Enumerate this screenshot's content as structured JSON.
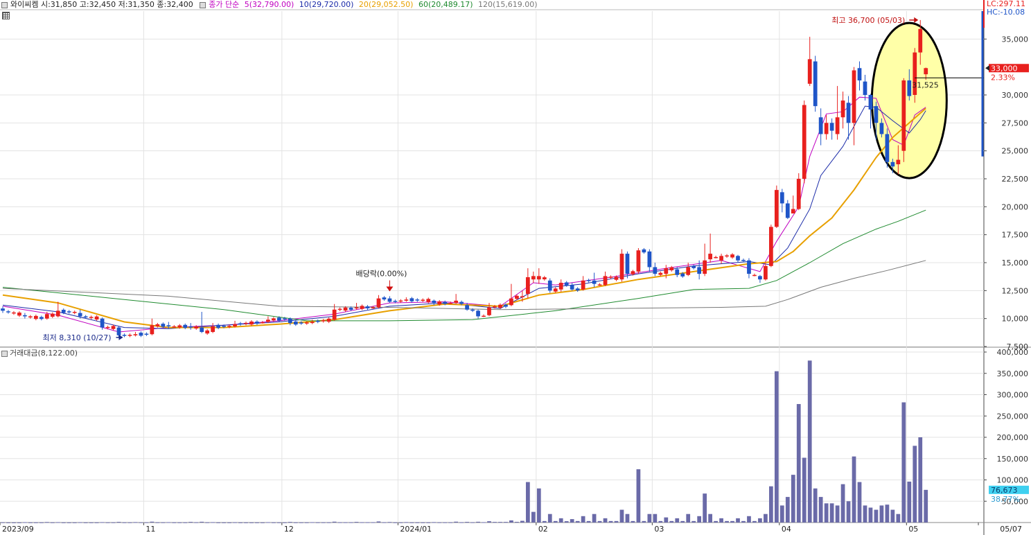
{
  "header": {
    "stock_info": "와이씨켐 시:31,850 고:32,450 저:31,350 종:32,400",
    "ma_title": "종가 단순",
    "ma": [
      {
        "label": "5(32,790.00)",
        "color": "#c000c0"
      },
      {
        "label": "10(29,720.00)",
        "color": "#1a2aa8"
      },
      {
        "label": "20(29,052.50)",
        "color": "#e8a000"
      },
      {
        "label": "60(20,489.17)",
        "color": "#1e8a2e"
      },
      {
        "label": "120(15,619.00)",
        "color": "#777777"
      }
    ]
  },
  "right_panel": {
    "lc": "LC:297.11",
    "hc": "HC:-10.08",
    "price_tag": "33,000",
    "price_change": "2.33%",
    "vol_tag": "76,673",
    "vol_change": "38.77%"
  },
  "volume_panel": {
    "label": "거래대금(8,122.00)"
  },
  "annotations": {
    "high": "최고 36,700 (05/03)",
    "low": "최저 8,310 (10/27)",
    "dividend": "배당락(0.00%)",
    "crosshair_value": "31,525"
  },
  "colors": {
    "up": "#e8201e",
    "down": "#1f55c8",
    "volume": "#6a6aa8",
    "highlight_fill": "#ffffa8"
  },
  "chart_data": {
    "type": "candlestick",
    "price_ylim": [
      7500,
      37500
    ],
    "price_ticks": [
      7500,
      10000,
      12500,
      15000,
      17500,
      20000,
      22500,
      25000,
      27500,
      30000,
      35000
    ],
    "price_tick_labels": [
      "7,500",
      "10,000",
      "12,500",
      "15,000",
      "17,500",
      "20,000",
      "22,500",
      "25,000",
      "27,500",
      "30,000",
      "35,000"
    ],
    "volume_ylim": [
      0,
      400000
    ],
    "volume_ticks": [
      50000,
      100000,
      150000,
      200000,
      250000,
      300000,
      350000,
      400000
    ],
    "volume_tick_labels": [
      "50,000",
      "100,000",
      "150,000",
      "200,000",
      "250,000",
      "300,000",
      "350,000",
      "400,000"
    ],
    "x_labels": [
      {
        "label": "2023/09",
        "index": 0
      },
      {
        "label": "11",
        "index": 26
      },
      {
        "label": "12",
        "index": 51
      },
      {
        "label": "2024/01",
        "index": 72
      },
      {
        "label": "02",
        "index": 97
      },
      {
        "label": "03",
        "index": 118
      },
      {
        "label": "04",
        "index": 141
      },
      {
        "label": "05",
        "index": 164
      },
      {
        "label": "05/07",
        "index": 177
      }
    ],
    "x_count": 178,
    "low_marker_index": 22,
    "dividend_marker_index": 70,
    "candle_anchors": [
      [
        0,
        10900,
        10700,
        11100,
        10500,
        500
      ],
      [
        4,
        10300,
        10200,
        10500,
        10000,
        800
      ],
      [
        8,
        10000,
        10400,
        10600,
        9900,
        1200
      ],
      [
        10,
        10200,
        10700,
        11500,
        10100,
        900
      ],
      [
        14,
        10500,
        10200,
        10800,
        10000,
        700
      ],
      [
        18,
        10000,
        9200,
        10100,
        9000,
        900
      ],
      [
        21,
        9200,
        8500,
        9300,
        8310,
        1500
      ],
      [
        24,
        8500,
        8600,
        8800,
        8400,
        1000
      ],
      [
        27,
        8600,
        9400,
        10000,
        8500,
        2000
      ],
      [
        30,
        9400,
        9300,
        9700,
        9100,
        800
      ],
      [
        34,
        9300,
        9200,
        9600,
        9000,
        1500
      ],
      [
        36,
        9200,
        8800,
        10600,
        8700,
        1800
      ],
      [
        38,
        8800,
        9300,
        9600,
        8700,
        900
      ],
      [
        42,
        9300,
        9500,
        9800,
        9200,
        600
      ],
      [
        48,
        9700,
        9900,
        10200,
        9600,
        800
      ],
      [
        52,
        10000,
        9600,
        10100,
        9400,
        1400
      ],
      [
        56,
        9600,
        9700,
        9900,
        9500,
        800
      ],
      [
        60,
        9900,
        10800,
        11300,
        9800,
        2000
      ],
      [
        64,
        10900,
        11000,
        11400,
        10800,
        1500
      ],
      [
        68,
        11000,
        11800,
        12100,
        10900,
        2500
      ],
      [
        70,
        11800,
        11500,
        12000,
        11400,
        1200
      ],
      [
        73,
        11600,
        11700,
        11900,
        11500,
        1000
      ],
      [
        78,
        11600,
        11400,
        11700,
        11200,
        1000
      ],
      [
        82,
        11400,
        11600,
        12200,
        11300,
        2000
      ],
      [
        84,
        11200,
        10800,
        11400,
        10700,
        1500
      ],
      [
        86,
        10700,
        10200,
        10800,
        10000,
        1800
      ],
      [
        88,
        10300,
        11000,
        11400,
        10200,
        3000
      ],
      [
        92,
        11200,
        11800,
        13100,
        11100,
        5000
      ],
      [
        94,
        12000,
        12000,
        12500,
        11500,
        4000
      ],
      [
        95,
        12200,
        13700,
        14500,
        11800,
        95000
      ],
      [
        96,
        13500,
        13800,
        14200,
        13200,
        25000
      ],
      [
        97,
        13500,
        13800,
        14500,
        13100,
        80000
      ],
      [
        99,
        13400,
        12500,
        13600,
        12300,
        20000
      ],
      [
        101,
        12600,
        13200,
        13500,
        12400,
        10000
      ],
      [
        103,
        13000,
        12600,
        13200,
        12500,
        8000
      ],
      [
        105,
        12600,
        13400,
        13800,
        12500,
        15000
      ],
      [
        107,
        13400,
        13100,
        14100,
        12800,
        20000
      ],
      [
        109,
        13000,
        13800,
        14200,
        12900,
        10000
      ],
      [
        112,
        13500,
        15800,
        16200,
        13300,
        30000
      ],
      [
        113,
        15800,
        14000,
        16000,
        13600,
        20000
      ],
      [
        115,
        14200,
        16100,
        16300,
        14000,
        125000
      ],
      [
        117,
        16000,
        14600,
        16200,
        14200,
        20000
      ],
      [
        118,
        14600,
        14000,
        15000,
        13800,
        20000
      ],
      [
        120,
        14000,
        14500,
        14800,
        13600,
        12000
      ],
      [
        122,
        14400,
        13900,
        14600,
        13700,
        10000
      ],
      [
        124,
        13900,
        14600,
        15000,
        13800,
        20000
      ],
      [
        126,
        14600,
        14000,
        15200,
        13500,
        15000
      ],
      [
        127,
        14000,
        15200,
        16700,
        13800,
        68000
      ],
      [
        128,
        15300,
        15800,
        17600,
        15000,
        20000
      ],
      [
        130,
        15200,
        15600,
        15800,
        14900,
        10000
      ],
      [
        133,
        15600,
        15200,
        15700,
        15000,
        10000
      ],
      [
        135,
        15200,
        14000,
        15400,
        13600,
        15000
      ],
      [
        137,
        13800,
        13500,
        13900,
        13200,
        10000
      ],
      [
        138,
        13500,
        14700,
        15000,
        13400,
        20000
      ],
      [
        139,
        14700,
        18200,
        18400,
        14600,
        85000
      ],
      [
        140,
        18200,
        21500,
        21900,
        18100,
        355000
      ],
      [
        141,
        21300,
        20300,
        21600,
        19500,
        40000
      ],
      [
        142,
        20300,
        19000,
        20600,
        18900,
        60000
      ],
      [
        143,
        19400,
        19800,
        21000,
        19400,
        112000
      ],
      [
        144,
        19800,
        22500,
        23000,
        19700,
        278000
      ],
      [
        145,
        22500,
        29100,
        29500,
        22100,
        152000
      ],
      [
        146,
        31000,
        33200,
        35200,
        30800,
        380000
      ],
      [
        147,
        33000,
        29000,
        33500,
        28500,
        80000
      ],
      [
        148,
        28000,
        26500,
        28800,
        25500,
        60000
      ],
      [
        149,
        26500,
        27500,
        28200,
        26000,
        45000
      ],
      [
        150,
        27500,
        26800,
        27900,
        26000,
        45000
      ],
      [
        151,
        26500,
        28000,
        30800,
        26000,
        40000
      ],
      [
        152,
        28000,
        29500,
        30300,
        27000,
        90000
      ],
      [
        153,
        29300,
        27500,
        29900,
        26000,
        50000
      ],
      [
        154,
        27500,
        32200,
        32500,
        25500,
        155000
      ],
      [
        155,
        32400,
        31300,
        33000,
        30400,
        95000
      ],
      [
        156,
        31200,
        30000,
        31800,
        29500,
        40000
      ],
      [
        157,
        30000,
        28700,
        30100,
        27000,
        35000
      ],
      [
        158,
        29000,
        27500,
        29400,
        26000,
        30000
      ],
      [
        159,
        27500,
        26500,
        27900,
        26200,
        40000
      ],
      [
        160,
        26500,
        24000,
        27000,
        23500,
        42000
      ],
      [
        161,
        24000,
        23600,
        24300,
        23000,
        30000
      ],
      [
        162,
        23800,
        24200,
        25500,
        22900,
        20000
      ],
      [
        163,
        25000,
        31300,
        31500,
        24000,
        282000
      ],
      [
        164,
        31300,
        29900,
        32300,
        29500,
        96000
      ],
      [
        165,
        30000,
        33800,
        34200,
        29300,
        180000
      ],
      [
        166,
        33800,
        35900,
        36700,
        32700,
        200000
      ],
      [
        167,
        31850,
        32400,
        32450,
        31350,
        76673
      ]
    ],
    "moving_averages": [
      {
        "name": "5",
        "color": "#c000c0",
        "points": [
          [
            0,
            11100
          ],
          [
            10,
            10300
          ],
          [
            21,
            8800
          ],
          [
            30,
            9200
          ],
          [
            40,
            9400
          ],
          [
            50,
            9800
          ],
          [
            60,
            10400
          ],
          [
            70,
            11400
          ],
          [
            80,
            11500
          ],
          [
            90,
            11100
          ],
          [
            96,
            13200
          ],
          [
            100,
            13000
          ],
          [
            110,
            13700
          ],
          [
            120,
            14500
          ],
          [
            130,
            15200
          ],
          [
            137,
            14200
          ],
          [
            140,
            16900
          ],
          [
            144,
            20000
          ],
          [
            146,
            24500
          ],
          [
            149,
            28300
          ],
          [
            152,
            28500
          ],
          [
            155,
            29800
          ],
          [
            158,
            29700
          ],
          [
            161,
            26000
          ],
          [
            163,
            25500
          ],
          [
            165,
            28200
          ],
          [
            167,
            28900
          ]
        ]
      },
      {
        "name": "10",
        "color": "#1a2aa8",
        "points": [
          [
            0,
            11200
          ],
          [
            10,
            10600
          ],
          [
            22,
            9200
          ],
          [
            30,
            9100
          ],
          [
            40,
            9400
          ],
          [
            50,
            9700
          ],
          [
            60,
            10200
          ],
          [
            70,
            11100
          ],
          [
            80,
            11400
          ],
          [
            90,
            10900
          ],
          [
            97,
            12700
          ],
          [
            105,
            13100
          ],
          [
            115,
            14000
          ],
          [
            125,
            14700
          ],
          [
            135,
            15100
          ],
          [
            139,
            14800
          ],
          [
            142,
            16300
          ],
          [
            146,
            19800
          ],
          [
            148,
            22800
          ],
          [
            152,
            25400
          ],
          [
            156,
            29000
          ],
          [
            158,
            28900
          ],
          [
            161,
            27700
          ],
          [
            164,
            26600
          ],
          [
            166,
            27800
          ],
          [
            167,
            28600
          ]
        ]
      },
      {
        "name": "20",
        "color": "#e8a000",
        "points": [
          [
            0,
            12100
          ],
          [
            10,
            11400
          ],
          [
            22,
            9700
          ],
          [
            30,
            9200
          ],
          [
            40,
            9200
          ],
          [
            50,
            9500
          ],
          [
            60,
            9900
          ],
          [
            70,
            10700
          ],
          [
            80,
            11300
          ],
          [
            90,
            11100
          ],
          [
            97,
            12100
          ],
          [
            105,
            12600
          ],
          [
            115,
            13500
          ],
          [
            125,
            14200
          ],
          [
            135,
            14900
          ],
          [
            140,
            15100
          ],
          [
            143,
            16000
          ],
          [
            146,
            17400
          ],
          [
            150,
            19000
          ],
          [
            154,
            21500
          ],
          [
            158,
            24400
          ],
          [
            161,
            26200
          ],
          [
            164,
            27500
          ],
          [
            167,
            28800
          ]
        ]
      },
      {
        "name": "60",
        "color": "#1e8a2e",
        "points": [
          [
            0,
            12800
          ],
          [
            20,
            11800
          ],
          [
            40,
            10800
          ],
          [
            55,
            9800
          ],
          [
            70,
            9800
          ],
          [
            85,
            9900
          ],
          [
            100,
            10700
          ],
          [
            115,
            11800
          ],
          [
            125,
            12600
          ],
          [
            135,
            12700
          ],
          [
            140,
            13400
          ],
          [
            146,
            15000
          ],
          [
            152,
            16700
          ],
          [
            158,
            18000
          ],
          [
            162,
            18700
          ],
          [
            167,
            19700
          ]
        ]
      },
      {
        "name": "120",
        "color": "#777777",
        "points": [
          [
            0,
            12700
          ],
          [
            30,
            12000
          ],
          [
            50,
            11100
          ],
          [
            70,
            11000
          ],
          [
            90,
            10800
          ],
          [
            110,
            10900
          ],
          [
            130,
            11000
          ],
          [
            138,
            11100
          ],
          [
            142,
            11700
          ],
          [
            148,
            12800
          ],
          [
            154,
            13600
          ],
          [
            160,
            14300
          ],
          [
            167,
            15200
          ]
        ]
      }
    ]
  }
}
